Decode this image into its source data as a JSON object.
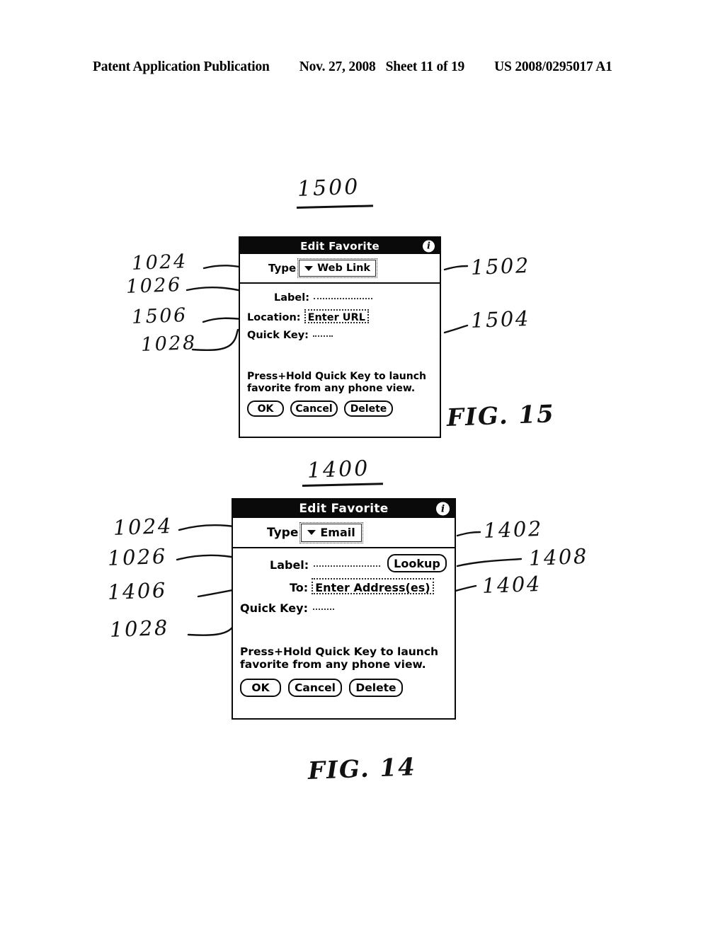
{
  "header": {
    "publication": "Patent Application Publication",
    "date": "Nov. 27, 2008",
    "sheet": "Sheet 11 of 19",
    "patent_number": "US 2008/0295017 A1"
  },
  "figures": [
    {
      "id": "fig15",
      "top_label": "1500",
      "caption": "FIG. 15",
      "dialog": {
        "title": "Edit Favorite",
        "info_icon_glyph": "i",
        "type_label": "Type",
        "type_value": "Web Link",
        "rows": [
          {
            "label": "Label:",
            "value": "",
            "style": "dotted-line"
          },
          {
            "label": "Location:",
            "value": "Enter URL",
            "style": "dotted-box"
          },
          {
            "label": "Quick Key:",
            "value": "",
            "style": "dotted-line-short"
          }
        ],
        "hint_line1": "Press+Hold Quick Key to launch",
        "hint_line2": "favorite from any phone view.",
        "buttons": [
          "OK",
          "Cancel",
          "Delete"
        ]
      },
      "callouts_left": [
        "1024",
        "1026",
        "1506",
        "1028"
      ],
      "callouts_right": [
        "1502",
        "1504"
      ]
    },
    {
      "id": "fig14",
      "top_label": "1400",
      "caption": "FIG. 14",
      "dialog": {
        "title": "Edit Favorite",
        "info_icon_glyph": "i",
        "type_label": "Type",
        "type_value": "Email",
        "rows": [
          {
            "label": "Label:",
            "value": "",
            "style": "dotted-line"
          },
          {
            "label": "To:",
            "value": "Enter Address(es)",
            "style": "dotted-box"
          },
          {
            "label": "Quick Key:",
            "value": "",
            "style": "dotted-line-short"
          }
        ],
        "lookup_button": "Lookup",
        "hint_line1": "Press+Hold Quick Key to launch",
        "hint_line2": "favorite from any phone view.",
        "buttons": [
          "OK",
          "Cancel",
          "Delete"
        ]
      },
      "callouts_left": [
        "1024",
        "1026",
        "1406",
        "1028"
      ],
      "callouts_right": [
        "1402",
        "1408",
        "1404"
      ]
    }
  ],
  "colors": {
    "ink": "#0a0a0a",
    "paper": "#ffffff",
    "titlebar_bg": "#0a0a0a",
    "titlebar_fg": "#ffffff"
  }
}
